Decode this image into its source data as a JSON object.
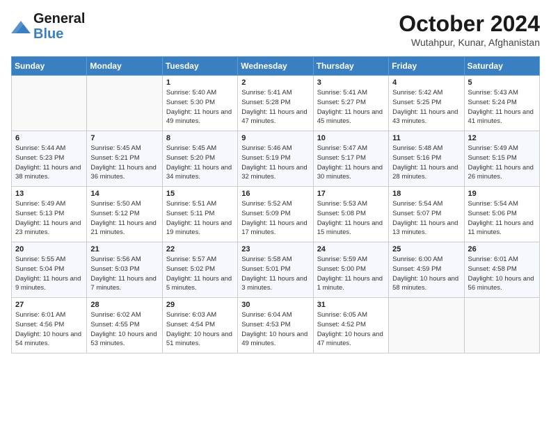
{
  "header": {
    "logo_line1": "General",
    "logo_line2": "Blue",
    "month_year": "October 2024",
    "location": "Wutahpur, Kunar, Afghanistan"
  },
  "weekdays": [
    "Sunday",
    "Monday",
    "Tuesday",
    "Wednesday",
    "Thursday",
    "Friday",
    "Saturday"
  ],
  "weeks": [
    [
      {
        "day": "",
        "info": ""
      },
      {
        "day": "",
        "info": ""
      },
      {
        "day": "1",
        "info": "Sunrise: 5:40 AM\nSunset: 5:30 PM\nDaylight: 11 hours and 49 minutes."
      },
      {
        "day": "2",
        "info": "Sunrise: 5:41 AM\nSunset: 5:28 PM\nDaylight: 11 hours and 47 minutes."
      },
      {
        "day": "3",
        "info": "Sunrise: 5:41 AM\nSunset: 5:27 PM\nDaylight: 11 hours and 45 minutes."
      },
      {
        "day": "4",
        "info": "Sunrise: 5:42 AM\nSunset: 5:25 PM\nDaylight: 11 hours and 43 minutes."
      },
      {
        "day": "5",
        "info": "Sunrise: 5:43 AM\nSunset: 5:24 PM\nDaylight: 11 hours and 41 minutes."
      }
    ],
    [
      {
        "day": "6",
        "info": "Sunrise: 5:44 AM\nSunset: 5:23 PM\nDaylight: 11 hours and 38 minutes."
      },
      {
        "day": "7",
        "info": "Sunrise: 5:45 AM\nSunset: 5:21 PM\nDaylight: 11 hours and 36 minutes."
      },
      {
        "day": "8",
        "info": "Sunrise: 5:45 AM\nSunset: 5:20 PM\nDaylight: 11 hours and 34 minutes."
      },
      {
        "day": "9",
        "info": "Sunrise: 5:46 AM\nSunset: 5:19 PM\nDaylight: 11 hours and 32 minutes."
      },
      {
        "day": "10",
        "info": "Sunrise: 5:47 AM\nSunset: 5:17 PM\nDaylight: 11 hours and 30 minutes."
      },
      {
        "day": "11",
        "info": "Sunrise: 5:48 AM\nSunset: 5:16 PM\nDaylight: 11 hours and 28 minutes."
      },
      {
        "day": "12",
        "info": "Sunrise: 5:49 AM\nSunset: 5:15 PM\nDaylight: 11 hours and 26 minutes."
      }
    ],
    [
      {
        "day": "13",
        "info": "Sunrise: 5:49 AM\nSunset: 5:13 PM\nDaylight: 11 hours and 23 minutes."
      },
      {
        "day": "14",
        "info": "Sunrise: 5:50 AM\nSunset: 5:12 PM\nDaylight: 11 hours and 21 minutes."
      },
      {
        "day": "15",
        "info": "Sunrise: 5:51 AM\nSunset: 5:11 PM\nDaylight: 11 hours and 19 minutes."
      },
      {
        "day": "16",
        "info": "Sunrise: 5:52 AM\nSunset: 5:09 PM\nDaylight: 11 hours and 17 minutes."
      },
      {
        "day": "17",
        "info": "Sunrise: 5:53 AM\nSunset: 5:08 PM\nDaylight: 11 hours and 15 minutes."
      },
      {
        "day": "18",
        "info": "Sunrise: 5:54 AM\nSunset: 5:07 PM\nDaylight: 11 hours and 13 minutes."
      },
      {
        "day": "19",
        "info": "Sunrise: 5:54 AM\nSunset: 5:06 PM\nDaylight: 11 hours and 11 minutes."
      }
    ],
    [
      {
        "day": "20",
        "info": "Sunrise: 5:55 AM\nSunset: 5:04 PM\nDaylight: 11 hours and 9 minutes."
      },
      {
        "day": "21",
        "info": "Sunrise: 5:56 AM\nSunset: 5:03 PM\nDaylight: 11 hours and 7 minutes."
      },
      {
        "day": "22",
        "info": "Sunrise: 5:57 AM\nSunset: 5:02 PM\nDaylight: 11 hours and 5 minutes."
      },
      {
        "day": "23",
        "info": "Sunrise: 5:58 AM\nSunset: 5:01 PM\nDaylight: 11 hours and 3 minutes."
      },
      {
        "day": "24",
        "info": "Sunrise: 5:59 AM\nSunset: 5:00 PM\nDaylight: 11 hours and 1 minute."
      },
      {
        "day": "25",
        "info": "Sunrise: 6:00 AM\nSunset: 4:59 PM\nDaylight: 10 hours and 58 minutes."
      },
      {
        "day": "26",
        "info": "Sunrise: 6:01 AM\nSunset: 4:58 PM\nDaylight: 10 hours and 56 minutes."
      }
    ],
    [
      {
        "day": "27",
        "info": "Sunrise: 6:01 AM\nSunset: 4:56 PM\nDaylight: 10 hours and 54 minutes."
      },
      {
        "day": "28",
        "info": "Sunrise: 6:02 AM\nSunset: 4:55 PM\nDaylight: 10 hours and 53 minutes."
      },
      {
        "day": "29",
        "info": "Sunrise: 6:03 AM\nSunset: 4:54 PM\nDaylight: 10 hours and 51 minutes."
      },
      {
        "day": "30",
        "info": "Sunrise: 6:04 AM\nSunset: 4:53 PM\nDaylight: 10 hours and 49 minutes."
      },
      {
        "day": "31",
        "info": "Sunrise: 6:05 AM\nSunset: 4:52 PM\nDaylight: 10 hours and 47 minutes."
      },
      {
        "day": "",
        "info": ""
      },
      {
        "day": "",
        "info": ""
      }
    ]
  ]
}
